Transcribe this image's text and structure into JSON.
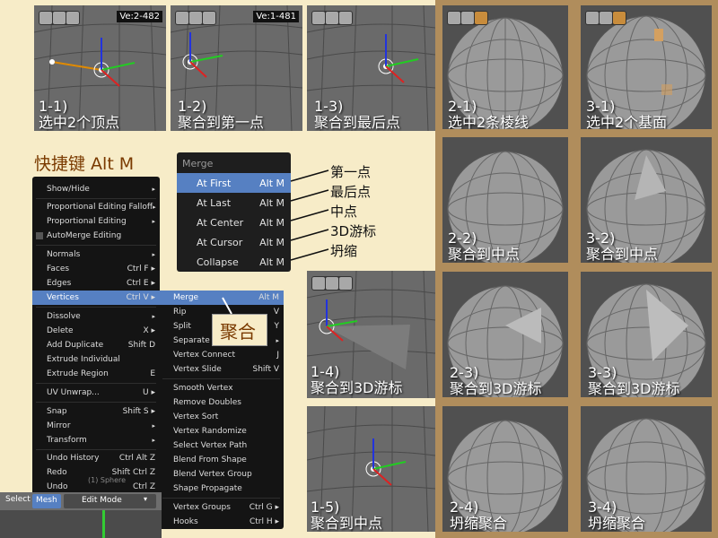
{
  "top_panels": [
    {
      "version": "Ve:2-482",
      "caption_num": "1-1)",
      "caption_text": "选中2个顶点"
    },
    {
      "version": "Ve:1-481",
      "caption_num": "1-2)",
      "caption_text": "聚合到第一点"
    },
    {
      "version": "",
      "caption_num": "1-3)",
      "caption_text": "聚合到最后点"
    }
  ],
  "right_panels_2": [
    {
      "caption_num": "2-1)",
      "caption_text": "选中2条棱线"
    },
    {
      "caption_num": "2-2)",
      "caption_text": "聚合到中点"
    },
    {
      "caption_num": "2-3)",
      "caption_text": "聚合到3D游标"
    },
    {
      "caption_num": "2-4)",
      "caption_text": "坍缩聚合"
    }
  ],
  "right_panels_3": [
    {
      "caption_num": "3-1)",
      "caption_text": "选中2个基面"
    },
    {
      "caption_num": "3-2)",
      "caption_text": "聚合到中点"
    },
    {
      "caption_num": "3-3)",
      "caption_text": "聚合到3D游标"
    },
    {
      "caption_num": "3-4)",
      "caption_text": "坍缩聚合"
    }
  ],
  "mid_panels": [
    {
      "caption_num": "1-4)",
      "caption_text": "聚合到3D游标"
    },
    {
      "caption_num": "1-5)",
      "caption_text": "聚合到中点"
    }
  ],
  "shortcut_title": "快捷键 Alt M",
  "merge_menu": {
    "header": "Merge",
    "items": [
      {
        "label": "At First",
        "key": "Alt M"
      },
      {
        "label": "At Last",
        "key": "Alt M"
      },
      {
        "label": "At Center",
        "key": "Alt M"
      },
      {
        "label": "At Cursor",
        "key": "Alt M"
      },
      {
        "label": "Collapse",
        "key": "Alt M"
      }
    ]
  },
  "merge_labels_cn": [
    "第一点",
    "最后点",
    "中点",
    "3D游标",
    "坍缩"
  ],
  "callout": "聚合",
  "mesh_menu": [
    {
      "label": "Show/Hide",
      "key": "▸"
    },
    {
      "label": "Proportional Editing Falloff",
      "key": "▸"
    },
    {
      "label": "Proportional Editing",
      "key": "▸"
    },
    {
      "label": "AutoMerge Editing",
      "key": ""
    },
    {
      "label": "Normals",
      "key": "▸"
    },
    {
      "label": "Faces",
      "key": "Ctrl F ▸"
    },
    {
      "label": "Edges",
      "key": "Ctrl E ▸"
    },
    {
      "label": "Vertices",
      "key": "Ctrl V ▸"
    },
    {
      "label": "Dissolve",
      "key": "▸"
    },
    {
      "label": "Delete",
      "key": "X ▸"
    },
    {
      "label": "Add Duplicate",
      "key": "Shift D"
    },
    {
      "label": "Extrude Individual",
      "key": ""
    },
    {
      "label": "Extrude Region",
      "key": "E"
    },
    {
      "label": "UV Unwrap...",
      "key": "U ▸"
    },
    {
      "label": "Snap",
      "key": "Shift S ▸"
    },
    {
      "label": "Mirror",
      "key": "▸"
    },
    {
      "label": "Transform",
      "key": "▸"
    },
    {
      "label": "Undo History",
      "key": "Ctrl Alt Z"
    },
    {
      "label": "Redo",
      "key": "Shift Ctrl Z"
    },
    {
      "label": "Undo",
      "key": "Ctrl Z"
    }
  ],
  "vertices_menu": [
    {
      "label": "Merge",
      "key": "Alt M"
    },
    {
      "label": "Rip",
      "key": "V"
    },
    {
      "label": "Split",
      "key": "Y"
    },
    {
      "label": "Separate",
      "key": "▸"
    },
    {
      "label": "Vertex Connect",
      "key": "J"
    },
    {
      "label": "Vertex Slide",
      "key": "Shift V"
    },
    {
      "label": "Smooth Vertex",
      "key": ""
    },
    {
      "label": "Remove Doubles",
      "key": ""
    },
    {
      "label": "Vertex Sort",
      "key": ""
    },
    {
      "label": "Vertex Randomize",
      "key": ""
    },
    {
      "label": "Select Vertex Path",
      "key": ""
    },
    {
      "label": "Blend From Shape",
      "key": ""
    },
    {
      "label": "Blend Vertex Group",
      "key": ""
    },
    {
      "label": "Shape Propagate",
      "key": ""
    },
    {
      "label": "Vertex Groups",
      "key": "Ctrl G ▸"
    },
    {
      "label": "Hooks",
      "key": "Ctrl H ▸"
    }
  ],
  "statusbar": {
    "select": "Select",
    "mesh": "Mesh",
    "mode": "Edit Mode",
    "obj": "(1) Sphere"
  }
}
